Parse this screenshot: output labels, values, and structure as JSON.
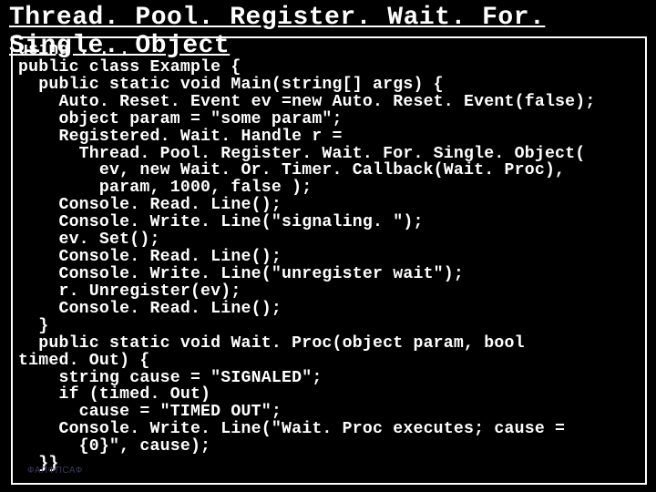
{
  "title": "Thread. Pool. Register. Wait. For. Single. Object",
  "code": {
    "l01": "using . . .",
    "l02": "public class Example {",
    "l03": "  public static void Main(string[] args) {",
    "l04": "    Auto. Reset. Event ev =new Auto. Reset. Event(false);",
    "l05": "    object param = \"some param\";",
    "l06": "    Registered. Wait. Handle r =",
    "l07": "      Thread. Pool. Register. Wait. For. Single. Object(",
    "l08": "        ev, new Wait. Or. Timer. Callback(Wait. Proc),",
    "l09": "        param, 1000, false );",
    "l10": "    Console. Read. Line();",
    "l11": "    Console. Write. Line(\"signaling. \");",
    "l12": "    ev. Set();",
    "l13": "    Console. Read. Line();",
    "l14": "    Console. Write. Line(\"unregister wait\");",
    "l15": "    r. Unregister(ev);",
    "l16": "    Console. Read. Line();",
    "l17": "  }",
    "l18": "  public static void Wait. Proc(object param, bool",
    "l19": "timed. Out) {",
    "l20": "    string cause = \"SIGNALED\";",
    "l21": "    if (timed. Out)",
    "l22": "      cause = \"TIMED OUT\";",
    "l23": "    Console. Write. Line(\"Wait. Proc executes; cause =",
    "l24": "      {0}\", cause);",
    "l25": "  }}"
  },
  "watermark": "ФАПФПСАФ"
}
